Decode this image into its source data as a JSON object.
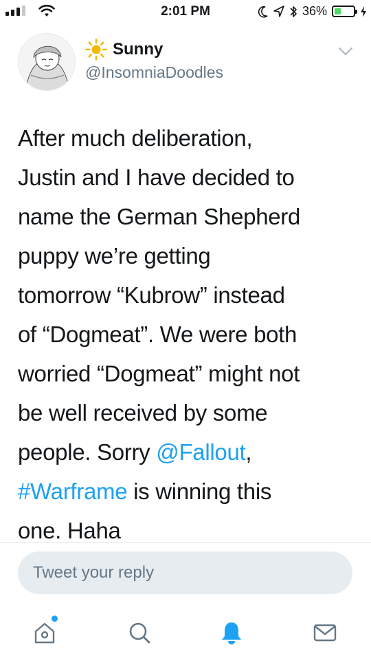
{
  "status_bar": {
    "time": "2:01 PM",
    "battery_text": "36%",
    "battery_level": 0.36,
    "icons": [
      "signal-icon",
      "wifi-icon",
      "moon-icon",
      "location-icon",
      "bluetooth-icon",
      "battery-icon",
      "charging-icon"
    ]
  },
  "tweet": {
    "display_name": "Sunny",
    "name_emoji": "☀",
    "username": "@InsomniaDoodles",
    "lines": [
      [
        "After much deliberation,"
      ],
      [
        "Justin and I have decided to"
      ],
      [
        "name the German Shepherd"
      ],
      [
        "puppy we’re getting"
      ],
      [
        "tomorrow “Kubrow” instead"
      ],
      [
        "of “Dogmeat”. We were both"
      ],
      [
        "worried “Dogmeat” might not"
      ],
      [
        "be well received by some"
      ],
      [
        "people. Sorry ",
        "@Fallout",
        ","
      ],
      [
        "#Warframe",
        " is winning this"
      ],
      [
        "one. Haha"
      ]
    ]
  },
  "reply": {
    "placeholder": "Tweet your reply"
  },
  "nav": {
    "items": [
      "home-icon",
      "search-icon",
      "notifications-icon",
      "messages-icon"
    ]
  },
  "colors": {
    "accent": "#1da1f2",
    "text": "#14171a",
    "muted": "#657786",
    "reply_bg": "#e6ecf0",
    "battery": "#4cd964",
    "sun": "#f5b800"
  }
}
